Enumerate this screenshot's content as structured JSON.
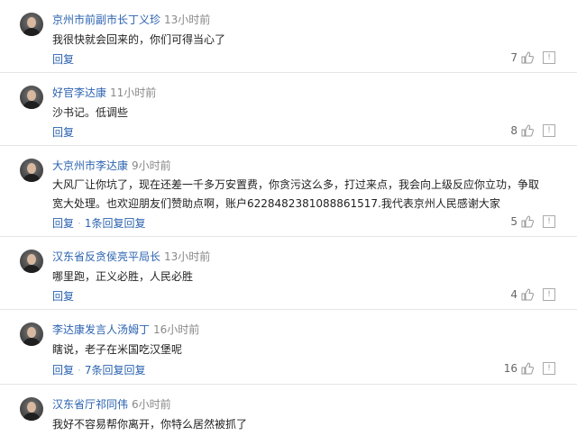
{
  "labels": {
    "reply": "回复",
    "report_glyph": "!"
  },
  "comments": [
    {
      "name": "京州市前副市长丁义珍",
      "time": "13小时前",
      "text": "我很快就会回来的，你们可得当心了",
      "likes": "7",
      "sub_replies": ""
    },
    {
      "name": "好官李达康",
      "time": "11小时前",
      "text": "沙书记。低调些",
      "likes": "8",
      "sub_replies": ""
    },
    {
      "name": "大京州市李达康",
      "time": "9小时前",
      "text": "大风厂让你坑了，现在还差一千多万安置费，你贪污这么多，打过来点，我会向上级反应你立功，争取宽大处理。也欢迎朋友们赞助点啊，账户6228482381088861517.我代表京州人民感谢大家",
      "likes": "5",
      "sub_replies": "1条回复"
    },
    {
      "name": "汉东省反贪侯亮平局长",
      "time": "13小时前",
      "text": "哪里跑，正义必胜，人民必胜",
      "likes": "4",
      "sub_replies": ""
    },
    {
      "name": "李达康发言人汤姆丁",
      "time": "16小时前",
      "text": "瞎说，老子在米国吃汉堡呢",
      "likes": "16",
      "sub_replies": "7条回复"
    },
    {
      "name": "汉东省厅祁同伟",
      "time": "6小时前",
      "text": "我好不容易帮你离开，你特么居然被抓了",
      "likes": "",
      "sub_replies": ""
    }
  ]
}
